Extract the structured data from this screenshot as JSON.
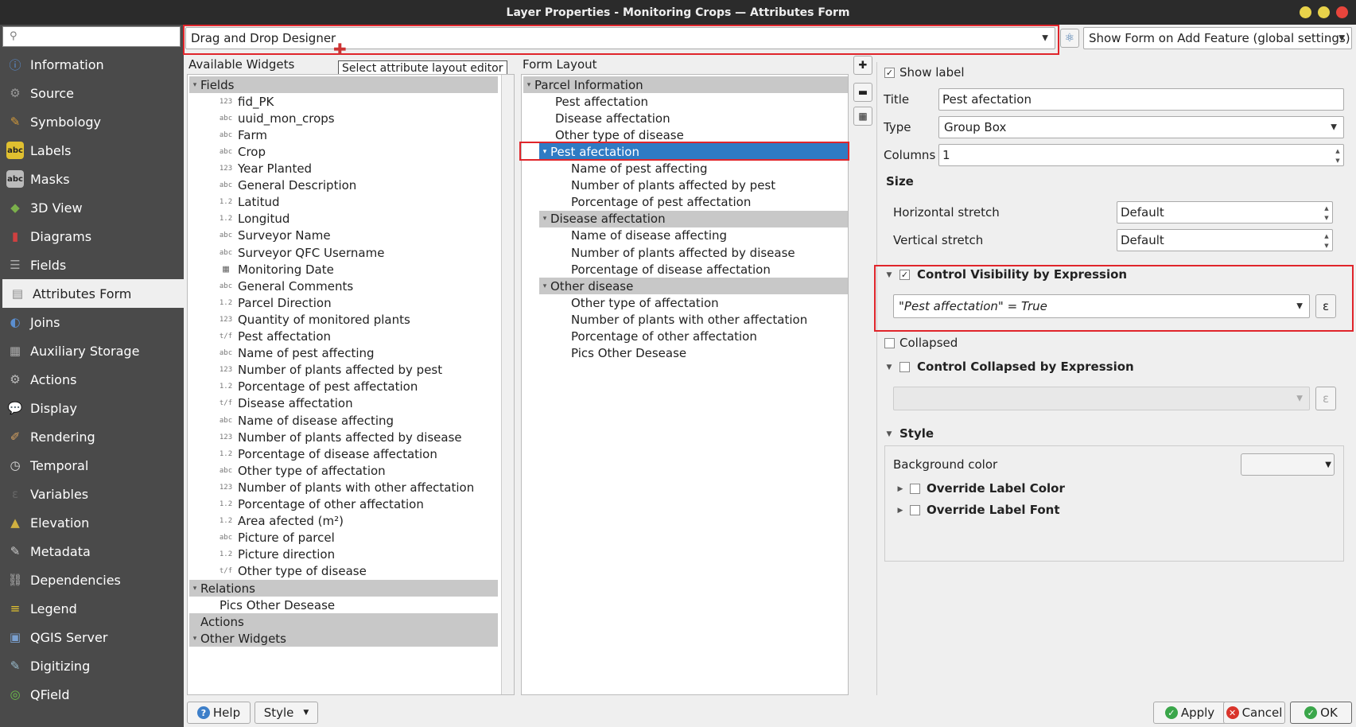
{
  "window": {
    "title": "Layer Properties - Monitoring Crops — Attributes Form"
  },
  "colors": {
    "selection": "#2f7bc4",
    "highlight": "#e0252b",
    "sidebar": "#4a4a4a"
  },
  "sidebar": {
    "search_placeholder": "",
    "items": [
      {
        "label": "Information",
        "icon": "info-icon"
      },
      {
        "label": "Source",
        "icon": "source-icon"
      },
      {
        "label": "Symbology",
        "icon": "symbology-icon"
      },
      {
        "label": "Labels",
        "icon": "labels-icon"
      },
      {
        "label": "Masks",
        "icon": "masks-icon"
      },
      {
        "label": "3D View",
        "icon": "cube-icon"
      },
      {
        "label": "Diagrams",
        "icon": "diagrams-icon"
      },
      {
        "label": "Fields",
        "icon": "fields-icon"
      },
      {
        "label": "Attributes Form",
        "icon": "form-icon"
      },
      {
        "label": "Joins",
        "icon": "joins-icon"
      },
      {
        "label": "Auxiliary Storage",
        "icon": "storage-icon"
      },
      {
        "label": "Actions",
        "icon": "gear-icon"
      },
      {
        "label": "Display",
        "icon": "display-icon"
      },
      {
        "label": "Rendering",
        "icon": "brush-icon"
      },
      {
        "label": "Temporal",
        "icon": "clock-icon"
      },
      {
        "label": "Variables",
        "icon": "variables-icon"
      },
      {
        "label": "Elevation",
        "icon": "elevation-icon"
      },
      {
        "label": "Metadata",
        "icon": "metadata-icon"
      },
      {
        "label": "Dependencies",
        "icon": "dependencies-icon"
      },
      {
        "label": "Legend",
        "icon": "legend-icon"
      },
      {
        "label": "QGIS Server",
        "icon": "server-icon"
      },
      {
        "label": "Digitizing",
        "icon": "digitizing-icon"
      },
      {
        "label": "QField",
        "icon": "qfield-icon"
      }
    ]
  },
  "topbar": {
    "editor_combo": "Drag and Drop Designer",
    "tooltip": "Select attribute layout editor",
    "suppress_combo": "Show Form on Add Feature (global settings)"
  },
  "available": {
    "header": "Available Widgets",
    "fields_label": "Fields",
    "fields": [
      {
        "type": "123",
        "name": "fid_PK"
      },
      {
        "type": "abc",
        "name": "uuid_mon_crops"
      },
      {
        "type": "abc",
        "name": "Farm"
      },
      {
        "type": "abc",
        "name": "Crop"
      },
      {
        "type": "123",
        "name": "Year Planted"
      },
      {
        "type": "abc",
        "name": "General Description"
      },
      {
        "type": "1.2",
        "name": "Latitud"
      },
      {
        "type": "1.2",
        "name": "Longitud"
      },
      {
        "type": "abc",
        "name": "Surveyor Name"
      },
      {
        "type": "abc",
        "name": "Surveyor QFC Username"
      },
      {
        "type": "cal",
        "name": "Monitoring Date"
      },
      {
        "type": "abc",
        "name": "General Comments"
      },
      {
        "type": "1.2",
        "name": "Parcel Direction"
      },
      {
        "type": "123",
        "name": "Quantity of monitored plants"
      },
      {
        "type": "t/f",
        "name": "Pest affectation"
      },
      {
        "type": "abc",
        "name": "Name of pest affecting"
      },
      {
        "type": "123",
        "name": "Number of plants affected by pest"
      },
      {
        "type": "1.2",
        "name": "Porcentage of pest affectation"
      },
      {
        "type": "t/f",
        "name": "Disease affectation"
      },
      {
        "type": "abc",
        "name": "Name of disease affecting"
      },
      {
        "type": "123",
        "name": "Number of plants affected by disease"
      },
      {
        "type": "1.2",
        "name": "Porcentage of disease affectation"
      },
      {
        "type": "abc",
        "name": "Other type of affectation"
      },
      {
        "type": "123",
        "name": "Number of plants with other affectation"
      },
      {
        "type": "1.2",
        "name": "Porcentage of other affectation"
      },
      {
        "type": "1.2",
        "name": "Area afected (m²)"
      },
      {
        "type": "abc",
        "name": "Picture of parcel"
      },
      {
        "type": "1.2",
        "name": "Picture direction"
      },
      {
        "type": "t/f",
        "name": "Other type of disease"
      }
    ],
    "relations_label": "Relations",
    "relations": [
      "Pics Other Desease"
    ],
    "actions_label": "Actions",
    "other_label": "Other Widgets"
  },
  "layout": {
    "header": "Form Layout",
    "rows": [
      {
        "text": "Parcel Information",
        "level": 0,
        "kind": "group"
      },
      {
        "text": "Pest affectation",
        "level": 1,
        "kind": "item"
      },
      {
        "text": "Disease affectation",
        "level": 1,
        "kind": "item"
      },
      {
        "text": "Other type of disease",
        "level": 1,
        "kind": "item"
      },
      {
        "text": "Pest afectation",
        "level": 1,
        "kind": "selected"
      },
      {
        "text": "Name of pest affecting",
        "level": 2,
        "kind": "item"
      },
      {
        "text": "Number of plants affected by pest",
        "level": 2,
        "kind": "item"
      },
      {
        "text": "Porcentage of pest affectation",
        "level": 2,
        "kind": "item"
      },
      {
        "text": "Disease affectation",
        "level": 1,
        "kind": "group"
      },
      {
        "text": "Name of disease affecting",
        "level": 2,
        "kind": "item"
      },
      {
        "text": "Number of plants affected by disease",
        "level": 2,
        "kind": "item"
      },
      {
        "text": "Porcentage of disease affectation",
        "level": 2,
        "kind": "item"
      },
      {
        "text": "Other disease",
        "level": 1,
        "kind": "group"
      },
      {
        "text": "Other type of affectation",
        "level": 2,
        "kind": "item"
      },
      {
        "text": "Number of plants with other affectation",
        "level": 2,
        "kind": "item"
      },
      {
        "text": "Porcentage of other affectation",
        "level": 2,
        "kind": "item"
      },
      {
        "text": "Pics Other Desease",
        "level": 2,
        "kind": "item"
      }
    ]
  },
  "props": {
    "show_label": "Show label",
    "title_label": "Title",
    "title_value": "Pest afectation",
    "type_label": "Type",
    "type_value": "Group Box",
    "columns_label": "Columns",
    "columns_value": "1",
    "size_header": "Size",
    "hstretch_label": "Horizontal stretch",
    "hstretch_value": "Default",
    "vstretch_label": "Vertical stretch",
    "vstretch_value": "Default",
    "visibility_header": "Control Visibility by Expression",
    "visibility_expr": "\"Pest affectation\" = True",
    "collapsed_label": "Collapsed",
    "collapsed_expr_header": "Control Collapsed by Expression",
    "style_header": "Style",
    "bgcolor_label": "Background color",
    "override_color": "Override Label Color",
    "override_font": "Override Label Font",
    "epsilon": "ε"
  },
  "buttons": {
    "help": "Help",
    "style": "Style",
    "apply": "Apply",
    "cancel": "Cancel",
    "ok": "OK"
  }
}
